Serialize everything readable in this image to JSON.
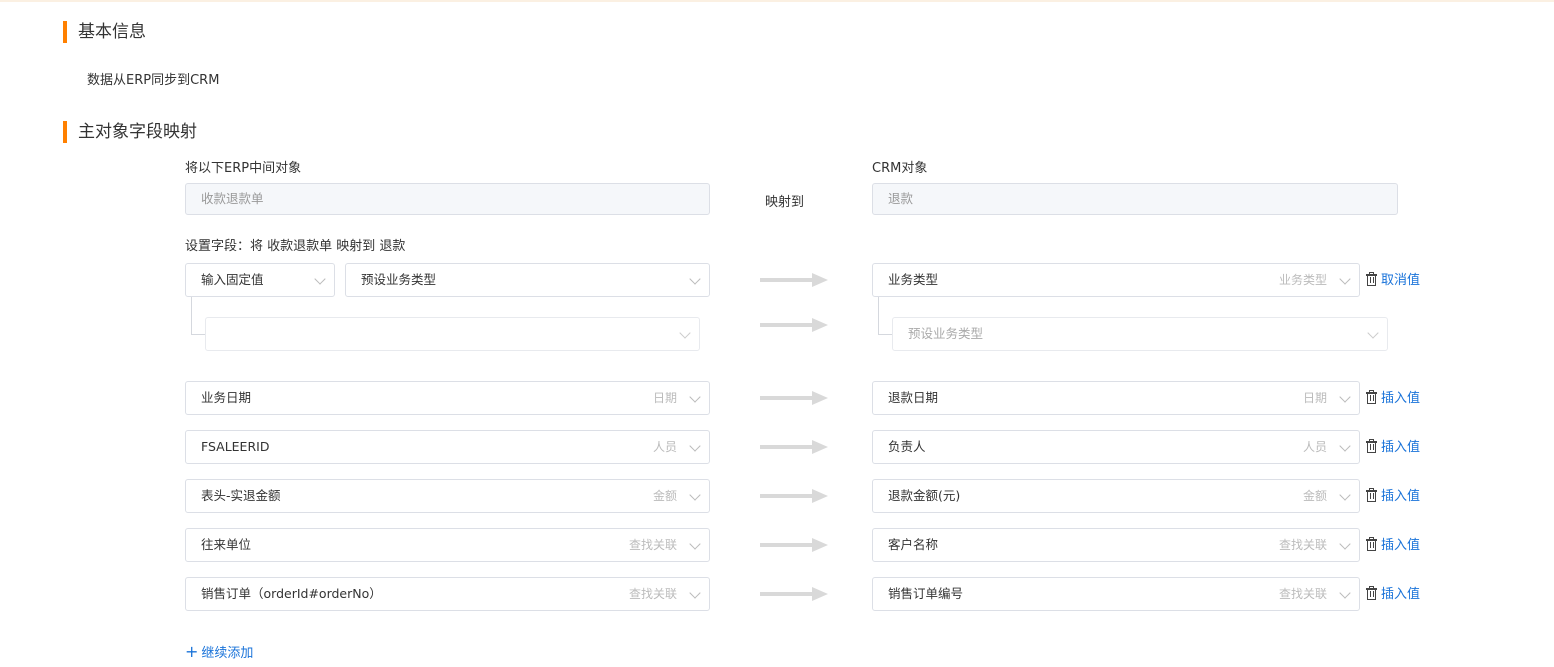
{
  "basic_info": {
    "title": "基本信息",
    "description": "数据从ERP同步到CRM"
  },
  "mapping": {
    "title": "主对象字段映射",
    "erp_object_label": "将以下ERP中间对象",
    "crm_object_label": "CRM对象",
    "erp_object_value": "收款退款单",
    "crm_object_value": "退款",
    "maps_to_label": "映射到",
    "set_fields_label": "设置字段：将 收款退款单 映射到 退款",
    "fixed_row": {
      "mode_select": "输入固定值",
      "value_select": "预设业务类型",
      "sub_select": "",
      "crm_field": "业务类型",
      "crm_hint": "业务类型",
      "crm_sub_placeholder": "预设业务类型",
      "action": "取消值"
    },
    "rows": [
      {
        "erp_field": "业务日期",
        "erp_hint": "日期",
        "crm_field": "退款日期",
        "crm_hint": "日期",
        "action": "插入值"
      },
      {
        "erp_field": "FSALEERID",
        "erp_hint": "人员",
        "crm_field": "负责人",
        "crm_hint": "人员",
        "action": "插入值"
      },
      {
        "erp_field": "表头-实退金额",
        "erp_hint": "金额",
        "crm_field": "退款金额(元)",
        "crm_hint": "金额",
        "action": "插入值"
      },
      {
        "erp_field": "往来单位",
        "erp_hint": "查找关联",
        "crm_field": "客户名称",
        "crm_hint": "查找关联",
        "action": "插入值"
      },
      {
        "erp_field": "销售订单（orderId#orderNo）",
        "erp_hint": "查找关联",
        "crm_field": "销售订单编号",
        "crm_hint": "查找关联",
        "action": "插入值"
      }
    ],
    "add_more": "继续添加"
  },
  "colors": {
    "accent": "#ff8000",
    "link": "#1a73d9",
    "border": "#dcdfe6",
    "disabled_bg": "#f5f7fa",
    "arrow": "#d9d9d9"
  }
}
